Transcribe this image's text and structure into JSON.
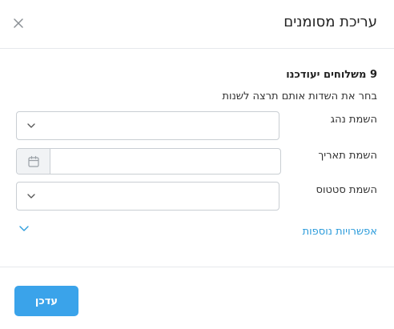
{
  "modal": {
    "title": "עריכת מסומנים",
    "summary": "9 משלוחים יעודכנו",
    "hint": "בחר את השדות אותם תרצה לשנות"
  },
  "fields": {
    "driver": {
      "label": "השמת נהג",
      "value": ""
    },
    "date": {
      "label": "השמת תאריך",
      "value": ""
    },
    "status": {
      "label": "השמת סטטוס",
      "value": ""
    }
  },
  "more_options": {
    "label": "אפשרויות נוספות"
  },
  "footer": {
    "update_label": "עדכן"
  },
  "colors": {
    "accent": "#3aa3ea",
    "link": "#2d9cdb",
    "border": "#c9ced3",
    "divider": "#e6e9ec"
  },
  "icons": {
    "close": "close-icon",
    "chevron": "chevron-down-icon",
    "calendar": "calendar-icon"
  }
}
